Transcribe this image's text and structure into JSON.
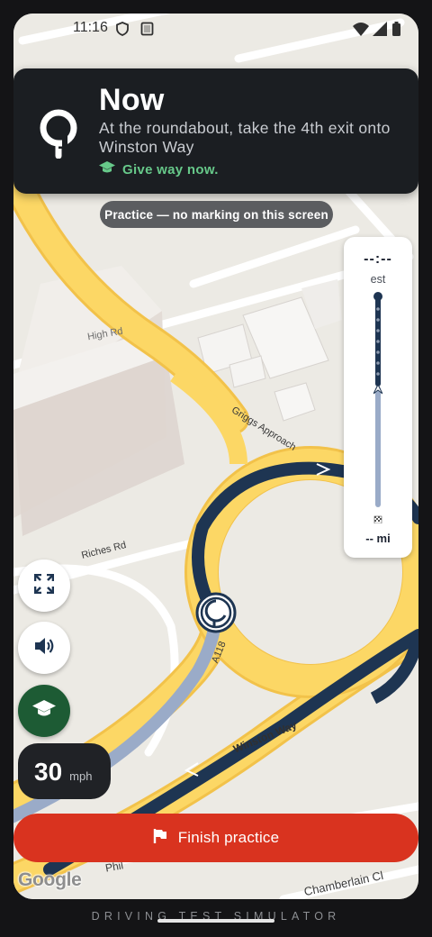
{
  "status_bar": {
    "time": "11:16",
    "icons": [
      "shield-icon",
      "sd-card-icon",
      "wifi-icon",
      "signal-icon",
      "battery-icon"
    ]
  },
  "nav_banner": {
    "title": "Now",
    "instruction": "At the roundabout, take the 4th exit onto Winston Way",
    "tip": "Give way now.",
    "maneuver_icon": "roundabout-icon",
    "tip_icon": "graduation-cap-icon"
  },
  "practice_chip": "Practice — no marking on this screen",
  "progress_panel": {
    "eta_time": "--:--",
    "eta_label": "est",
    "distance_remaining": "-- mi",
    "end_icon": "checkered-flag-icon"
  },
  "controls": {
    "fullscreen_icon": "fullscreen-icon",
    "volume_icon": "volume-icon",
    "learn_icon": "graduation-cap-icon"
  },
  "speed": {
    "value": "30",
    "unit": "mph"
  },
  "finish_button": {
    "label": "Finish practice",
    "icon": "flag-icon"
  },
  "map": {
    "streets": {
      "high_rd": "High Rd",
      "griggs": "Griggs Approach",
      "riches": "Riches Rd",
      "a118": "A118",
      "winston": "Winston Way",
      "phil": "Phil",
      "chamberlain": "Chamberlain Cl"
    },
    "attribution": "Google"
  },
  "footer": "DRIVING TEST SIMULATOR",
  "colors": {
    "route": "#1e3552",
    "traveled": "#9aabc8",
    "main_road": "#fcd765",
    "finish": "#d9331f",
    "tip": "#67c98a",
    "banner": "#1b1e22"
  }
}
